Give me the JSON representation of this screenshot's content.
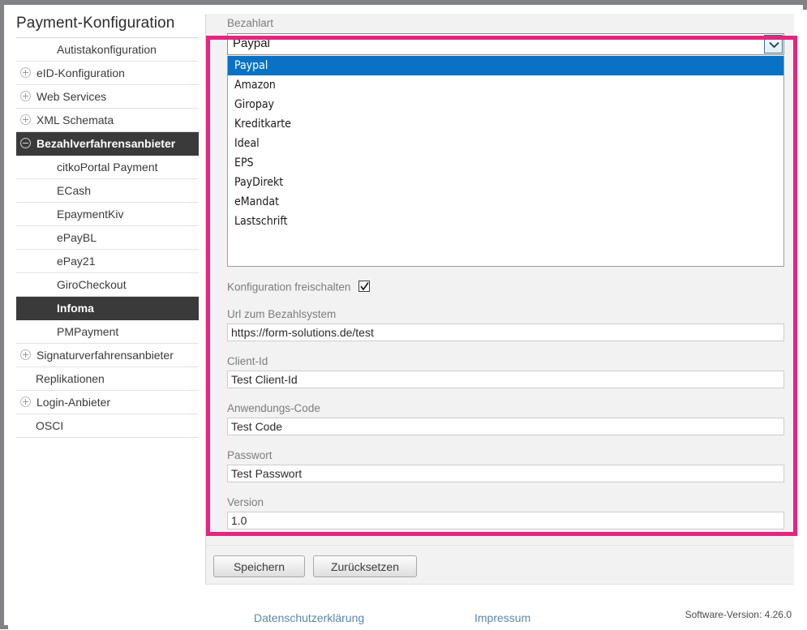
{
  "page": {
    "title": "Payment-Konfiguration"
  },
  "sidebar": {
    "items": [
      {
        "label": "Autistakonfiguration",
        "level": 1,
        "toggle": "none",
        "selected": false
      },
      {
        "label": "eID-Konfiguration",
        "level": 0,
        "toggle": "plus",
        "selected": false
      },
      {
        "label": "Web Services",
        "level": 0,
        "toggle": "plus",
        "selected": false
      },
      {
        "label": "XML Schemata",
        "level": 0,
        "toggle": "plus",
        "selected": false
      },
      {
        "label": "Bezahlverfahrensanbieter",
        "level": 0,
        "toggle": "minus",
        "selected": true
      },
      {
        "label": "citkoPortal Payment",
        "level": 1,
        "toggle": "none",
        "selected": false
      },
      {
        "label": "ECash",
        "level": 1,
        "toggle": "none",
        "selected": false
      },
      {
        "label": "EpaymentKiv",
        "level": 1,
        "toggle": "none",
        "selected": false
      },
      {
        "label": "ePayBL",
        "level": 1,
        "toggle": "none",
        "selected": false
      },
      {
        "label": "ePay21",
        "level": 1,
        "toggle": "none",
        "selected": false
      },
      {
        "label": "GiroCheckout",
        "level": 1,
        "toggle": "none",
        "selected": false
      },
      {
        "label": "Infoma",
        "level": 1,
        "toggle": "none",
        "selected": true
      },
      {
        "label": "PMPayment",
        "level": 1,
        "toggle": "none",
        "selected": false
      },
      {
        "label": "Signaturverfahrensanbieter",
        "level": 0,
        "toggle": "plus",
        "selected": false
      },
      {
        "label": "Replikationen",
        "level": 0,
        "toggle": "none",
        "selected": false
      },
      {
        "label": "Login-Anbieter",
        "level": 0,
        "toggle": "plus",
        "selected": false
      },
      {
        "label": "OSCI",
        "level": 0,
        "toggle": "none",
        "selected": false
      }
    ]
  },
  "form": {
    "payment_type": {
      "label": "Bezahlart",
      "selected": "Paypal",
      "options": [
        "Paypal",
        "Amazon",
        "Giropay",
        "Kreditkarte",
        "Ideal",
        "EPS",
        "PayDirekt",
        "eMandat",
        "Lastschrift"
      ]
    },
    "enable_config": {
      "label": "Konfiguration freischalten",
      "checked": true
    },
    "fields": [
      {
        "label": "Url zum Bezahlsystem",
        "value": "https://form-solutions.de/test"
      },
      {
        "label": "Client-Id",
        "value": "Test Client-Id"
      },
      {
        "label": "Anwendungs-Code",
        "value": "Test Code"
      },
      {
        "label": "Passwort",
        "value": "Test Passwort"
      },
      {
        "label": "Version",
        "value": "1.0"
      }
    ],
    "buttons": {
      "save": "Speichern",
      "reset": "Zurücksetzen"
    }
  },
  "footer": {
    "privacy_link": "Datenschutzerklärung",
    "imprint_link": "Impressum",
    "software_version": "Software-Version: 4.26.0"
  },
  "colors": {
    "highlight_border": "#e5257f",
    "selected_nav": "#3a3a3a",
    "option_highlight": "#0a72c4",
    "link": "#5b87a8"
  }
}
